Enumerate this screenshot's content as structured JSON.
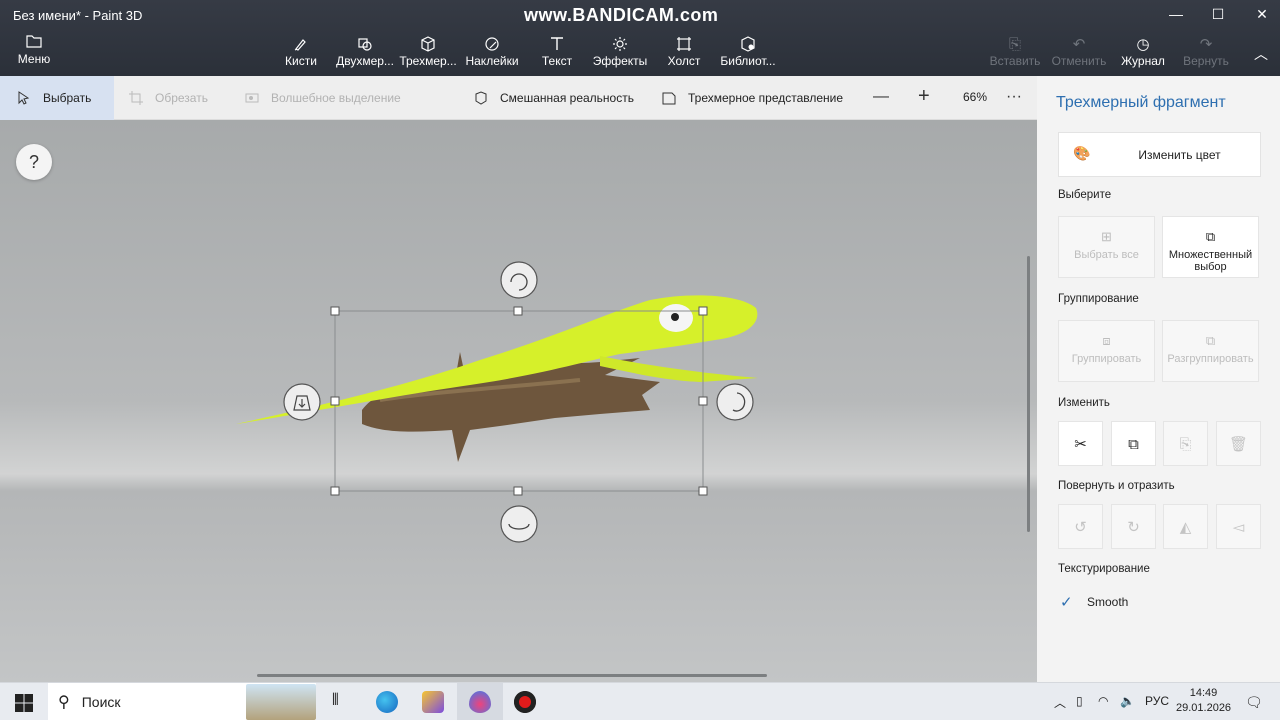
{
  "window": {
    "title": "Без имени* - Paint 3D",
    "watermark": "www.BANDICAM.com",
    "controls": {
      "minimize": "—",
      "maximize": "☐",
      "close": "✕"
    }
  },
  "menu": {
    "label": "Меню",
    "icon": "folder-icon"
  },
  "tools": [
    {
      "label": "Кисти",
      "icon": "brush-icon"
    },
    {
      "label": "Двухмер...",
      "icon": "2d-shapes-icon"
    },
    {
      "label": "Трехмер...",
      "icon": "3d-shapes-icon"
    },
    {
      "label": "Наклейки",
      "icon": "stickers-icon"
    },
    {
      "label": "Текст",
      "icon": "text-icon"
    },
    {
      "label": "Эффекты",
      "icon": "effects-icon"
    },
    {
      "label": "Холст",
      "icon": "canvas-icon"
    },
    {
      "label": "Библиот...",
      "icon": "library-icon"
    }
  ],
  "right_tools": [
    {
      "label": "Вставить",
      "icon": "paste-icon",
      "enabled": false
    },
    {
      "label": "Отменить",
      "icon": "undo-icon",
      "enabled": false
    },
    {
      "label": "Журнал",
      "icon": "history-icon",
      "enabled": true
    },
    {
      "label": "Вернуть",
      "icon": "redo-icon",
      "enabled": false
    }
  ],
  "subtoolbar": {
    "select": "Выбрать",
    "crop": "Обрезать",
    "magic_select": "Волшебное выделение",
    "mixed_reality": "Смешанная реальность",
    "view_3d": "Трехмерное представление",
    "zoom_out": "—",
    "zoom_in": "+",
    "zoom": "66%",
    "more": "···"
  },
  "canvas": {
    "help": "?"
  },
  "panel": {
    "title": "Трехмерный фрагмент",
    "change_color": "Изменить цвет",
    "select_heading": "Выберите",
    "select_all": "Выбрать все",
    "multi_select": "Множественный выбор",
    "group_heading": "Группирование",
    "group": "Группировать",
    "ungroup": "Разгруппировать",
    "edit_heading": "Изменить",
    "rotate_heading": "Повернуть и отразить",
    "texture_heading": "Текстурирование",
    "smooth_label": "Smooth",
    "smooth_checked": true
  },
  "taskbar": {
    "search_placeholder": "Поиск",
    "language": "РУС",
    "time": "14:49",
    "date": "29.01.2026"
  },
  "colors": {
    "accent": "#2e6fb0",
    "topbar": "#2f343d",
    "lizard": "#d6f02a",
    "log": "#6e563d"
  }
}
